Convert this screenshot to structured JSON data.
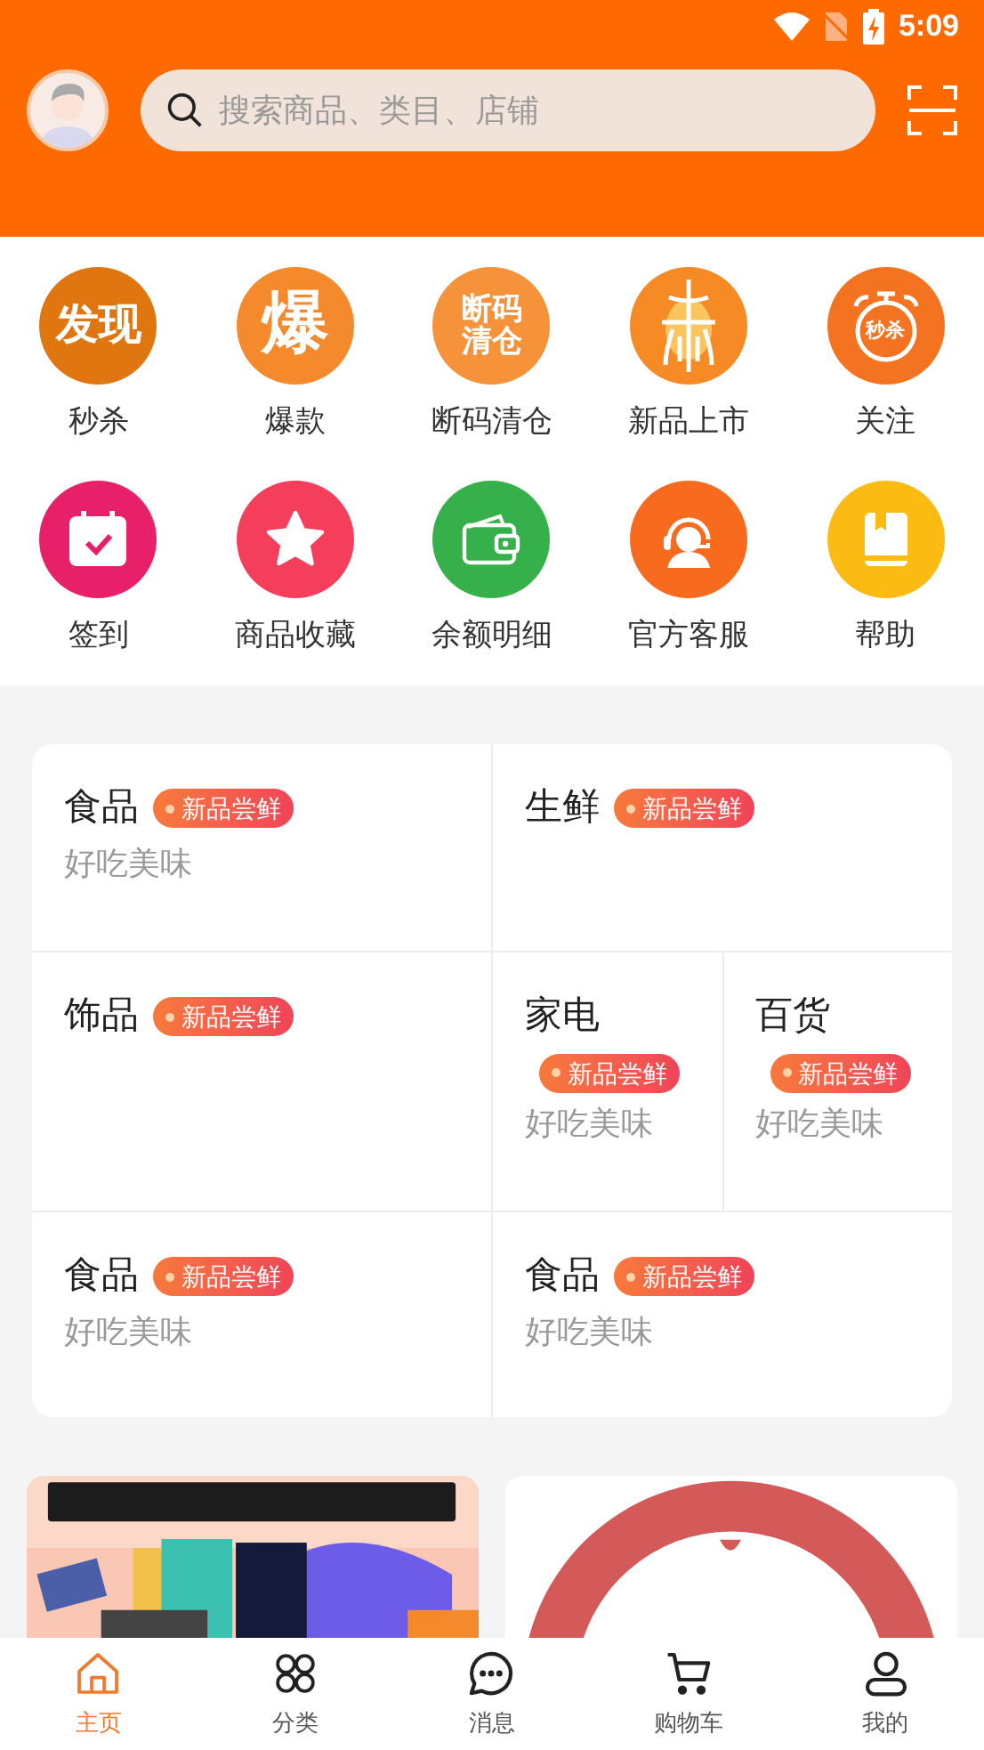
{
  "status_bar": {
    "time": "5:09"
  },
  "search": {
    "placeholder": "搜索商品、类目、店铺"
  },
  "shortcuts": [
    {
      "label": "秒杀",
      "kind": "text",
      "icon_text": "发现",
      "color": "#e0760f"
    },
    {
      "label": "爆款",
      "kind": "text",
      "icon_text": "爆",
      "color": "#f58a2c"
    },
    {
      "label": "断码清仓",
      "kind": "text",
      "icon_text": "断码清仓",
      "color": "#f5923a"
    },
    {
      "label": "新品上市",
      "kind": "launch",
      "color": "#f68a25"
    },
    {
      "label": "关注",
      "kind": "stopwatch",
      "icon_text": "秒杀",
      "color": "#f47320"
    },
    {
      "label": "签到",
      "kind": "calendar",
      "color": "#e8206a"
    },
    {
      "label": "商品收藏",
      "kind": "star",
      "color": "#f43e5c"
    },
    {
      "label": "余额明细",
      "kind": "wallet",
      "color": "#36b04a"
    },
    {
      "label": "官方客服",
      "kind": "headset",
      "color": "#f86a1e"
    },
    {
      "label": "帮助",
      "kind": "book",
      "color": "#fbbb12"
    }
  ],
  "categories": [
    [
      {
        "title": "食品",
        "tag": "新品尝鲜",
        "subtitle": "好吃美味",
        "kind": "inline"
      },
      {
        "title": "生鲜",
        "tag": "新品尝鲜",
        "kind": "inline"
      }
    ],
    [
      {
        "title": "饰品",
        "tag": "新品尝鲜",
        "kind": "inline"
      },
      {
        "title": "家电",
        "tag": "新品尝鲜",
        "subtitle": "好吃美味",
        "kind": "stacked"
      },
      {
        "title": "百货",
        "tag": "新品尝鲜",
        "subtitle": "好吃美味",
        "kind": "stacked"
      }
    ],
    [
      {
        "title": "食品",
        "tag": "新品尝鲜",
        "subtitle": "好吃美味",
        "kind": "inline"
      },
      {
        "title": "食品",
        "tag": "新品尝鲜",
        "subtitle": "好吃美味",
        "kind": "inline"
      }
    ]
  ],
  "promos": [
    {
      "kind": "picture"
    },
    {
      "kind": "picture"
    }
  ],
  "tabs": [
    {
      "label": "主页",
      "kind": "home",
      "selected": true
    },
    {
      "label": "分类",
      "kind": "grid",
      "selected": false
    },
    {
      "label": "消息",
      "kind": "chat",
      "selected": false
    },
    {
      "label": "购物车",
      "kind": "cart",
      "selected": false
    },
    {
      "label": "我的",
      "kind": "user",
      "selected": false
    }
  ]
}
